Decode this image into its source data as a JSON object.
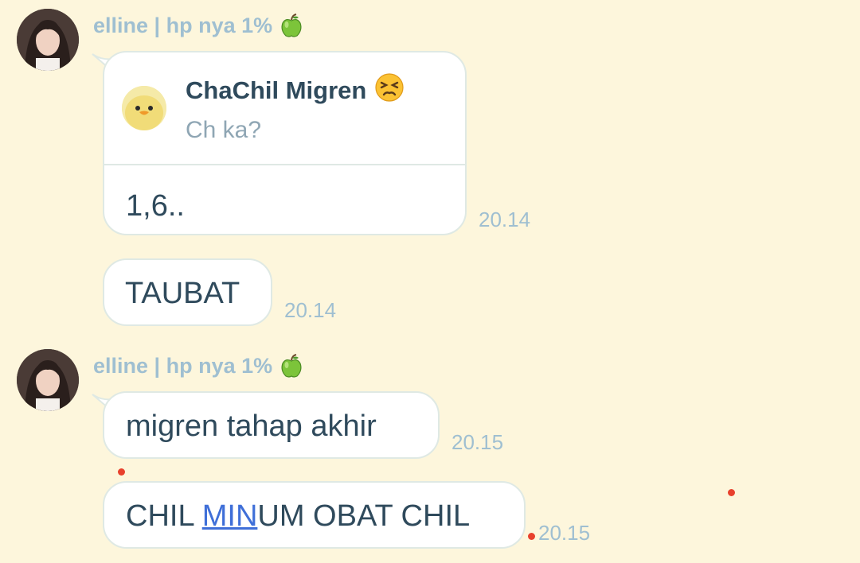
{
  "messages": [
    {
      "sender": "elline | hp nya 1%",
      "sender_icon": "green-apple-icon",
      "reply": {
        "name": "ChaChil Migren",
        "name_icon": "persevering-face-icon",
        "snippet": "Ch ka?"
      },
      "text": "1,6..",
      "time": "20.14"
    },
    {
      "text": "TAUBAT",
      "time": "20.14"
    },
    {
      "sender": "elline | hp nya 1%",
      "sender_icon": "green-apple-icon",
      "text": "migren tahap akhir",
      "time": "20.15"
    },
    {
      "text_parts": [
        "CHIL ",
        "MIN",
        "UM OBAT CHIL"
      ],
      "link_part": "MIN",
      "time": "20.15"
    }
  ],
  "colors": {
    "background": "#fdf6dc",
    "bubble": "#ffffff",
    "text": "#2f4a5c",
    "meta": "#9fbfd1",
    "link": "#3f6fd8"
  }
}
